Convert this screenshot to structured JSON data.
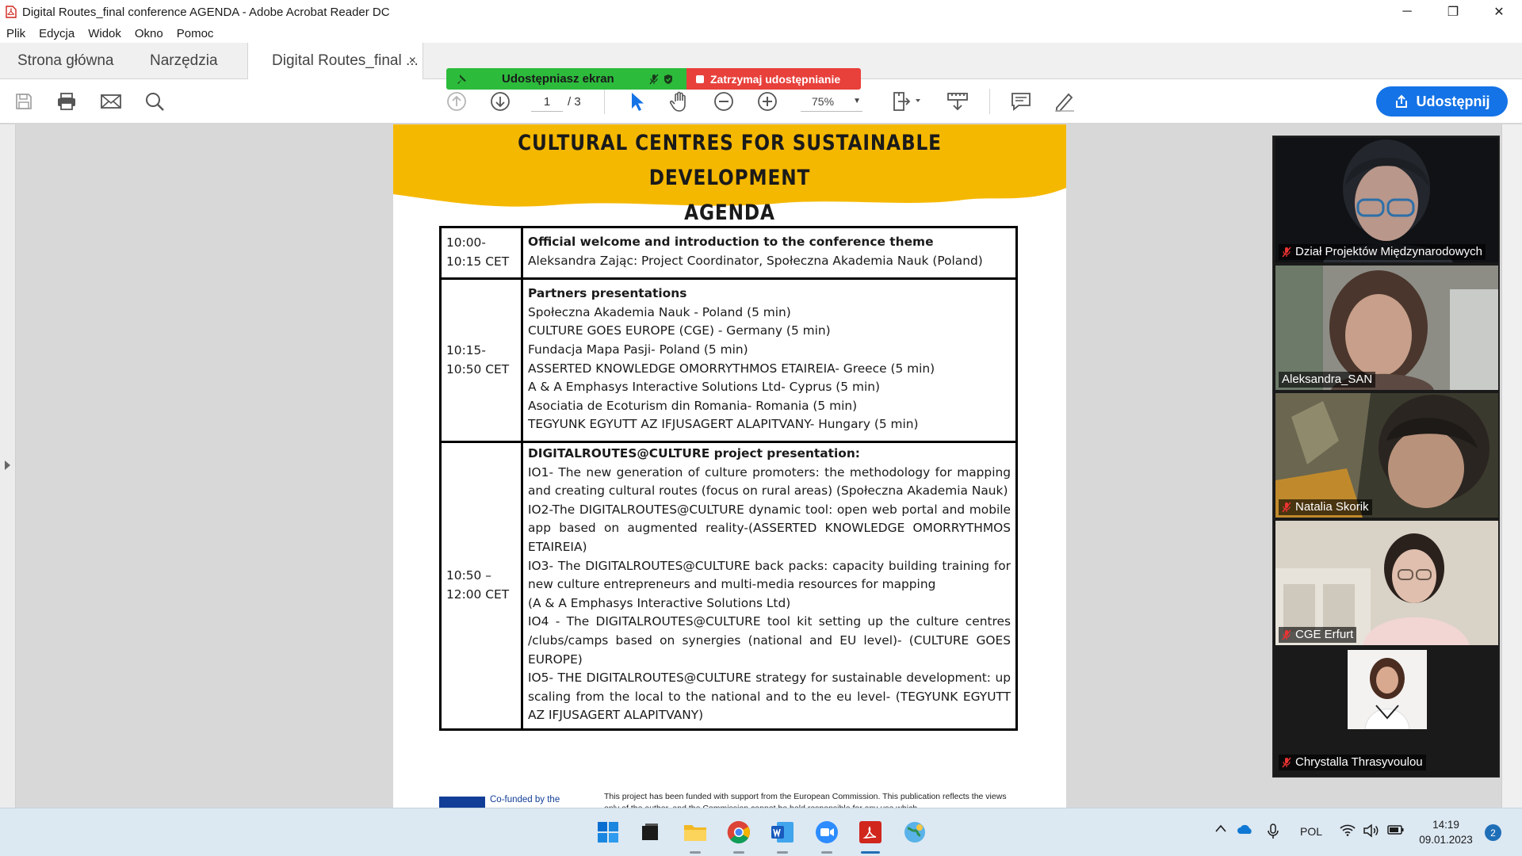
{
  "window": {
    "title": "Digital Routes_final conference AGENDA - Adobe Acrobat Reader DC",
    "minimize": "─",
    "restore": "❐",
    "close": "✕"
  },
  "menu": [
    "Plik",
    "Edycja",
    "Widok",
    "Okno",
    "Pomoc"
  ],
  "tabs": {
    "home": "Strona główna",
    "tools": "Narzędzia",
    "doc": "Digital Routes_final ...",
    "doc_close": "×"
  },
  "share_banner": {
    "sharing_label": "Udostępniasz ekran",
    "stop_label": "Zatrzymaj udostępnianie",
    "colors": {
      "green": "#2dbb3c",
      "red": "#e8403b"
    }
  },
  "toolbar": {
    "page_current": "1",
    "page_total": "/ 3",
    "zoom": "75%",
    "share_button": "Udostępnij",
    "accent": "#1473e6",
    "icons": [
      "save-icon",
      "print-icon",
      "mail-icon",
      "search-icon",
      "page-up-icon",
      "page-down-icon",
      "select-cursor-icon",
      "hand-icon",
      "zoom-out-icon",
      "zoom-in-icon",
      "fit-page-icon",
      "scroll-mode-icon",
      "comment-icon",
      "pen-icon"
    ]
  },
  "document": {
    "title_line1": "CULTURAL CENTRES FOR SUSTAINABLE DEVELOPMENT",
    "title_line2": "AGENDA",
    "banner_color": "#f5b800",
    "rows": [
      {
        "time1": "10:00-",
        "time2": "10:15 CET",
        "heading": "Official welcome and introduction to the conference theme",
        "lines": [
          "Aleksandra Zając: Project Coordinator, Społeczna Akademia Nauk (Poland)"
        ]
      },
      {
        "time1": "10:15-",
        "time2": "10:50 CET",
        "heading": "Partners presentations",
        "lines": [
          "Społeczna Akademia Nauk - Poland (5 min)",
          "CULTURE GOES EUROPE (CGE) - Germany  (5 min)",
          "Fundacja Mapa Pasji- Poland (5 min)",
          "ASSERTED KNOWLEDGE OMORRYTHMOS ETAIREIA- Greece (5 min)",
          "A & A Emphasys Interactive Solutions Ltd- Cyprus (5 min)",
          "Asociatia de Ecoturism din Romania- Romania (5 min)",
          "TEGYUNK EGYUTT AZ IFJUSAGERT ALAPITVANY- Hungary (5 min)"
        ]
      },
      {
        "time1": "10:50 –",
        "time2": "12:00 CET",
        "heading": "DIGITALROUTES@CULTURE project presentation:",
        "lines": [
          "IO1- The new generation of culture promoters: the methodology for mapping and creating cultural routes (focus on rural areas) (Społeczna Akademia Nauk)",
          "IO2-The DIGITALROUTES@CULTURE dynamic tool: open web portal and mobile app based on augmented reality-(ASSERTED KNOWLEDGE OMORRYTHMOS ETAIREIA)",
          "IO3-  The DIGITALROUTES@CULTURE back packs: capacity building training for new culture entrepreneurs and multi-media resources for mapping",
          "(A & A Emphasys Interactive Solutions Ltd)",
          "IO4 - The DIGITALROUTES@CULTURE tool kit setting up the culture centres /clubs/camps based on synergies (national and EU level)- (CULTURE GOES EUROPE)",
          "IO5- THE DIGITALROUTES@CULTURE strategy for sustainable development: up scaling from the local to the national and to the eu level- (TEGYUNK EGYUTT AZ IFJUSAGERT ALAPITVANY)"
        ]
      }
    ],
    "footer_cofunded": "Co-funded by the",
    "footer_note": "This project has been funded with support from the European Commission.  This publication reflects the views only of the author, and the Commission cannot be held responsible for any use which"
  },
  "zoom": {
    "participants": [
      {
        "name": "Dział Projektów Międzynarodowych",
        "muted": true,
        "active": false
      },
      {
        "name": "Aleksandra_SAN",
        "muted": false,
        "active": true
      },
      {
        "name": "Natalia Skorik",
        "muted": true,
        "active": false
      },
      {
        "name": "CGE Erfurt",
        "muted": true,
        "active": false
      },
      {
        "name": "Chrystalla Thrasyvoulou",
        "muted": true,
        "active": false
      }
    ]
  },
  "taskbar": {
    "apps": [
      "windows-start-icon",
      "task-view-icon",
      "file-explorer-icon",
      "chrome-icon",
      "word-icon",
      "zoom-icon",
      "acrobat-icon",
      "weather-globe-icon"
    ],
    "language": "POL",
    "time": "14:19",
    "date": "09.01.2023",
    "notifications": "2"
  }
}
